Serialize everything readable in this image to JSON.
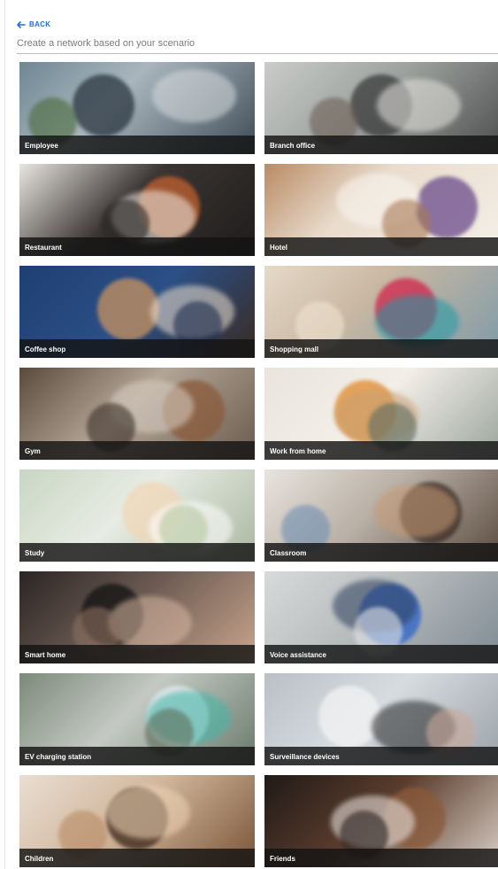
{
  "header": {
    "back_label": "BACK",
    "subtitle": "Create a network based on your scenario"
  },
  "colors": {
    "accent": "#1f6fd6",
    "label_bar": "#141414",
    "rule": "#bdbdbd"
  },
  "scenarios": [
    {
      "label": "Employee",
      "bg": "linear-gradient(135deg,#6f8794 0%,#a9b6bd 40%,#3f4c57 100%)",
      "a": "#2b3640",
      "b": "#d8dde0",
      "c": "#4a6a3c"
    },
    {
      "label": "Branch office",
      "bg": "linear-gradient(135deg,#c9ccc9 0%,#9ea29f 45%,#4d4f4e 100%)",
      "a": "#3a3b3c",
      "b": "#e8e6e2",
      "c": "#6b5f55"
    },
    {
      "label": "Restaurant",
      "bg": "linear-gradient(135deg,#e9e6e1 0%,#3a3533 45%,#1e1c1b 100%)",
      "a": "#c2622e",
      "b": "#f1ede8",
      "c": "#2a2726"
    },
    {
      "label": "Hotel",
      "bg": "linear-gradient(135deg,#b98b64 0%,#e9dccd 40%,#f4efe8 100%)",
      "a": "#6b4b8c",
      "b": "#faf7f2",
      "c": "#a87a55"
    },
    {
      "label": "Coffee shop",
      "bg": "linear-gradient(135deg,#1f3f73 0%,#2b4f86 50%,#3a2a22 100%)",
      "a": "#c9935f",
      "b": "#efe2cf",
      "c": "#1c2d4f"
    },
    {
      "label": "Shopping mall",
      "bg": "linear-gradient(135deg,#e6d9c8 0%,#c9b8a3 40%,#7f9aa8 100%)",
      "a": "#d2234a",
      "b": "#1c9aa5",
      "c": "#f0e4d2"
    },
    {
      "label": "Gym",
      "bg": "linear-gradient(135deg,#5a4a3b 0%,#b3a596 45%,#6a5b4e 100%)",
      "a": "#8a5a3a",
      "b": "#d8cfc4",
      "c": "#3a3028"
    },
    {
      "label": "Work from home",
      "bg": "linear-gradient(135deg,#e9e4dc 0%,#f3efe8 45%,#9aa39c 100%)",
      "a": "#e08a2c",
      "b": "#c8a074",
      "c": "#5c6c5f"
    },
    {
      "label": "Study",
      "bg": "linear-gradient(135deg,#c9d6c4 0%,#e8ece4 45%,#a9b7a0 100%)",
      "a": "#f0d7b8",
      "b": "#ffffff",
      "c": "#b7c9a2"
    },
    {
      "label": "Classroom",
      "bg": "linear-gradient(135deg,#e8e4de 0%,#b9b0a6 45%,#5a4b40 100%)",
      "a": "#3a2b24",
      "b": "#c69a74",
      "c": "#6f8fb3"
    },
    {
      "label": "Smart home",
      "bg": "linear-gradient(135deg,#2a2524 0%,#6b5a52 45%,#c9a58e 100%)",
      "a": "#111111",
      "b": "#d9b8a3",
      "c": "#8a6e5f"
    },
    {
      "label": "Voice assistance",
      "bg": "linear-gradient(135deg,#d7dadb 0%,#b8bcbd 45%,#7e8a93 100%)",
      "a": "#2d63c9",
      "b": "#2a3d5c",
      "c": "#e2e4e5"
    },
    {
      "label": "EV charging station",
      "bg": "linear-gradient(135deg,#7c8a7a 0%,#c4c9c3 45%,#6a7a6b 100%)",
      "a": "#e4eef2",
      "b": "#3fb6a8",
      "c": "#5d6e5c"
    },
    {
      "label": "Surveillance devices",
      "bg": "linear-gradient(135deg,#b9c0c6 0%,#d7dce0 45%,#9aa2a8 100%)",
      "a": "#f4f4f4",
      "b": "#232323",
      "c": "#c9a89a"
    },
    {
      "label": "Children",
      "bg": "linear-gradient(135deg,#e9ded3 0%,#d1b79c 45%,#7a5438 100%)",
      "a": "#3a2518",
      "b": "#f1d6b8",
      "c": "#b88a64"
    },
    {
      "label": "Friends",
      "bg": "linear-gradient(135deg,#1f1a18 0%,#5a3c2c 45%,#d9cfc6 100%)",
      "a": "#8a5a3a",
      "b": "#f0ece8",
      "c": "#2a2220"
    }
  ]
}
